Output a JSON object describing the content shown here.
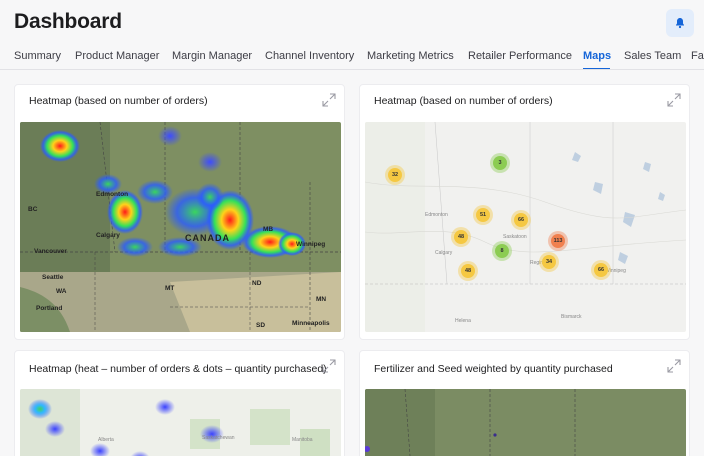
{
  "header": {
    "title": "Dashboard",
    "notifications_icon": "bell-icon",
    "accent_color": "#1565d8"
  },
  "tabs": [
    {
      "label": "Summary",
      "active": false
    },
    {
      "label": "Product Manager",
      "active": false
    },
    {
      "label": "Margin Manager",
      "active": false
    },
    {
      "label": "Channel Inventory",
      "active": false
    },
    {
      "label": "Marketing Metrics",
      "active": false
    },
    {
      "label": "Retailer Performance",
      "active": false
    },
    {
      "label": "Maps",
      "active": true
    },
    {
      "label": "Sales Team",
      "active": false
    },
    {
      "label": "Far",
      "active": false
    }
  ],
  "cards": [
    {
      "title": "Heatmap (based on number of orders)",
      "expand_icon": "expand-icon",
      "map_labels": [
        "BC",
        "Edmonton",
        "Calgary",
        "Vancouver",
        "Seattle",
        "WA",
        "Portland",
        "CANADA",
        "MB",
        "Winnipeg",
        "MT",
        "ND",
        "MN",
        "SD",
        "Minneapolis"
      ]
    },
    {
      "title": "Heatmap (based on number of orders)",
      "expand_icon": "expand-icon",
      "clusters": [
        {
          "count": "32",
          "color": "#f5c842"
        },
        {
          "count": "3",
          "color": "#8ccc52"
        },
        {
          "count": "51",
          "color": "#f5c842"
        },
        {
          "count": "66",
          "color": "#f5c842"
        },
        {
          "count": "48",
          "color": "#f5c842"
        },
        {
          "count": "8",
          "color": "#8ccc52"
        },
        {
          "count": "113",
          "color": "#f0804f"
        },
        {
          "count": "34",
          "color": "#f5c842"
        },
        {
          "count": "48",
          "color": "#f5c842"
        },
        {
          "count": "66",
          "color": "#f5c842"
        }
      ],
      "map_labels": [
        "Edmonton",
        "Calgary",
        "Saskatoon",
        "Regina",
        "Winnipeg",
        "Helena",
        "Bismarck"
      ]
    },
    {
      "title": "Heatmap (heat – number of orders & dots – quantity purchased)",
      "expand_icon": "expand-icon",
      "map_labels": [
        "Alberta",
        "Saskatchewan",
        "Manitoba"
      ]
    },
    {
      "title": "Fertilizer and Seed weighted by quantity purchased",
      "expand_icon": "expand-icon"
    }
  ]
}
